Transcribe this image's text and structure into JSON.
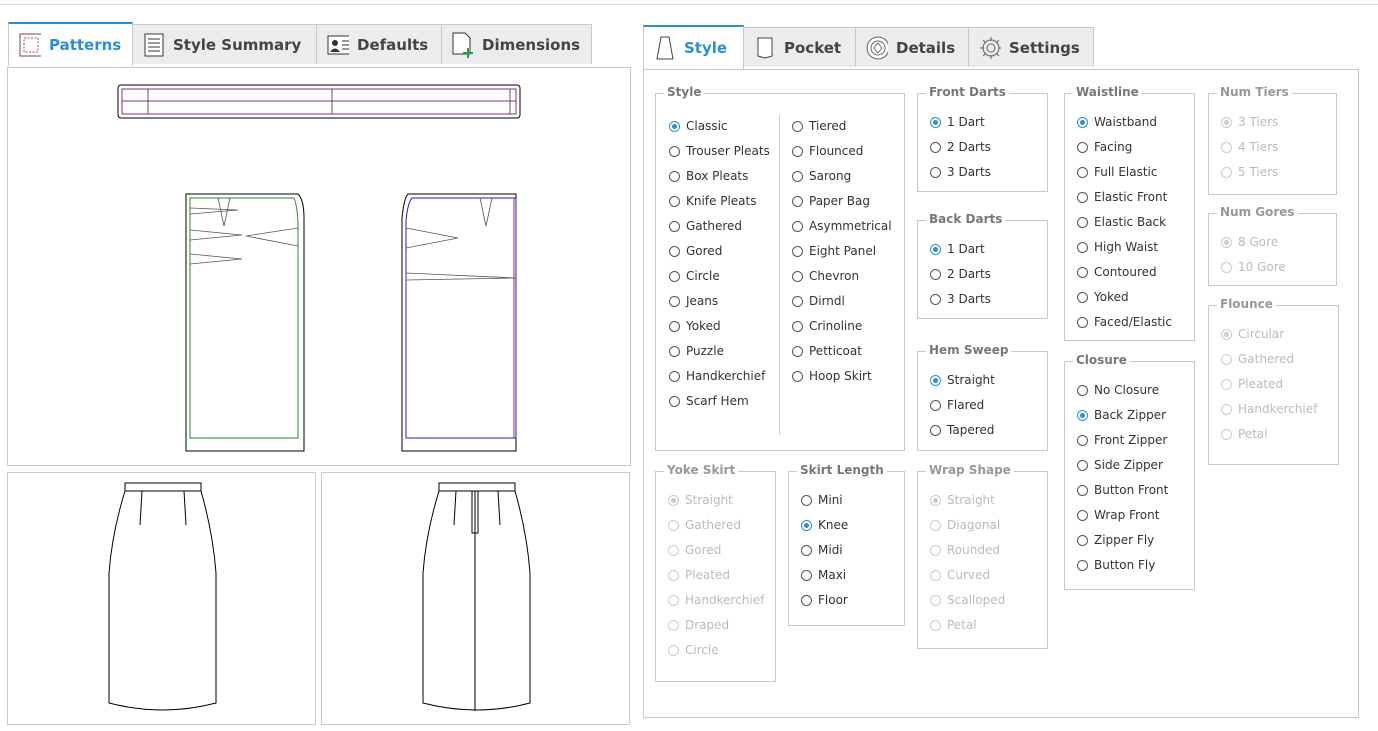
{
  "left_tabs": [
    {
      "label": "Patterns",
      "icon": "patterns-icon",
      "active": true
    },
    {
      "label": "Style Summary",
      "icon": "document-icon",
      "active": false
    },
    {
      "label": "Defaults",
      "icon": "contact-card-icon",
      "active": false
    },
    {
      "label": "Dimensions",
      "icon": "add-page-icon",
      "active": false
    }
  ],
  "right_tabs": [
    {
      "label": "Style",
      "icon": "skirt-icon",
      "active": true
    },
    {
      "label": "Pocket",
      "icon": "pocket-icon",
      "active": false
    },
    {
      "label": "Details",
      "icon": "details-icon",
      "active": false
    },
    {
      "label": "Settings",
      "icon": "gear-icon",
      "active": false
    }
  ],
  "style_group": {
    "title": "Style",
    "col1": [
      "Classic",
      "Trouser Pleats",
      "Box Pleats",
      "Knife Pleats",
      "Gathered",
      "Gored",
      "Circle",
      "Jeans",
      "Yoked",
      "Puzzle",
      "Handkerchief",
      "Scarf Hem"
    ],
    "col2": [
      "Tiered",
      "Flounced",
      "Sarong",
      "Paper Bag",
      "Asymmetrical",
      "Eight Panel",
      "Chevron",
      "Dirndl",
      "Crinoline",
      "Petticoat",
      "Hoop Skirt"
    ],
    "selected": "Classic"
  },
  "front_darts": {
    "title": "Front Darts",
    "options": [
      "1 Dart",
      "2 Darts",
      "3 Darts"
    ],
    "selected": "1 Dart"
  },
  "back_darts": {
    "title": "Back Darts",
    "options": [
      "1 Dart",
      "2 Darts",
      "3 Darts"
    ],
    "selected": "1 Dart"
  },
  "hem_sweep": {
    "title": "Hem Sweep",
    "options": [
      "Straight",
      "Flared",
      "Tapered"
    ],
    "selected": "Straight"
  },
  "waistline": {
    "title": "Waistline",
    "options": [
      "Waistband",
      "Facing",
      "Full Elastic",
      "Elastic Front",
      "Elastic Back",
      "High Waist",
      "Contoured",
      "Yoked",
      "Faced/Elastic"
    ],
    "selected": "Waistband"
  },
  "closure": {
    "title": "Closure",
    "options": [
      "No Closure",
      "Back Zipper",
      "Front Zipper",
      "Side Zipper",
      "Button Front",
      "Wrap Front",
      "Zipper Fly",
      "Button Fly"
    ],
    "selected": "Back Zipper"
  },
  "num_tiers": {
    "title": "Num Tiers",
    "options": [
      "3 Tiers",
      "4 Tiers",
      "5 Tiers"
    ],
    "selected": "3 Tiers"
  },
  "num_gores": {
    "title": "Num Gores",
    "options": [
      "8 Gore",
      "10 Gore"
    ],
    "selected": "8 Gore"
  },
  "flounce": {
    "title": "Flounce",
    "options": [
      "Circular",
      "Gathered",
      "Pleated",
      "Handkerchief",
      "Petal"
    ],
    "selected": "Circular"
  },
  "yoke_skirt": {
    "title": "Yoke Skirt",
    "options": [
      "Straight",
      "Gathered",
      "Gored",
      "Pleated",
      "Handkerchief",
      "Draped",
      "Circle"
    ],
    "selected": "Straight"
  },
  "skirt_length": {
    "title": "Skirt Length",
    "options": [
      "Mini",
      "Knee",
      "Midi",
      "Maxi",
      "Floor"
    ],
    "selected": "Knee"
  },
  "wrap_shape": {
    "title": "Wrap Shape",
    "options": [
      "Straight",
      "Diagonal",
      "Rounded",
      "Curved",
      "Scalloped",
      "Petal"
    ],
    "selected": "Straight"
  },
  "colors": {
    "accent": "#2a8fd6",
    "front_outline": "#2a8a2a",
    "back_outline": "#2222aa",
    "waistband_line": "#8a2a8a"
  }
}
